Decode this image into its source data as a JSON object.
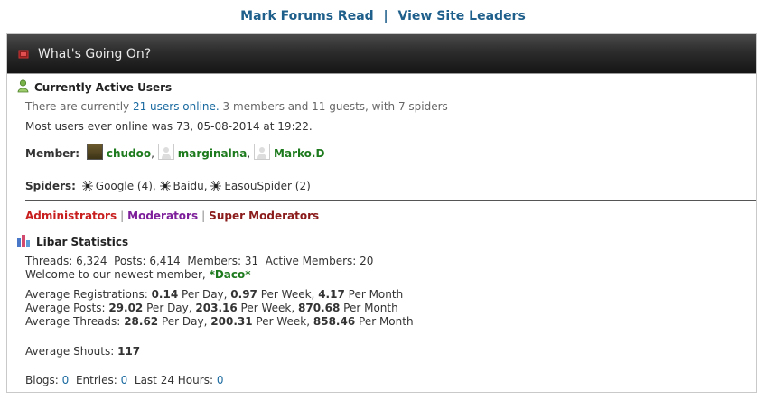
{
  "top_links": {
    "mark_forums_read": "Mark Forums Read",
    "separator": "|",
    "view_site_leaders": "View Site Leaders"
  },
  "panel": {
    "title": "What's Going On?"
  },
  "active_users": {
    "title": "Currently Active Users",
    "line1_prefix": "There are currently",
    "users_online_link": "21 users online.",
    "line1_suffix": "3 members and 11 guests, with 7 spiders",
    "most_users": "Most users ever online was 73, 05-08-2014 at 19:22.",
    "member_label": "Member:",
    "members": [
      "chudoo",
      "marginalna",
      "Marko.D"
    ],
    "spiders_label": "Spiders:",
    "spiders": [
      "Google (4)",
      "Baidu",
      "EasouSpider (2)"
    ],
    "legend": {
      "administrators": "Administrators",
      "moderators": "Moderators",
      "super_moderators": "Super Moderators",
      "sep": "|"
    }
  },
  "statistics": {
    "title": "Libar Statistics",
    "threads_label": "Threads:",
    "threads": "6,324",
    "posts_label": "Posts:",
    "posts": "6,414",
    "members_label": "Members:",
    "members": "31",
    "active_members_label": "Active Members:",
    "active_members": "20",
    "welcome_prefix": "Welcome to our newest member,",
    "newest_member": "*Daco*",
    "avg_reg": {
      "label": "Average Registrations:",
      "day": "0.14",
      "week": "0.97",
      "month": "4.17"
    },
    "avg_posts": {
      "label": "Average Posts:",
      "day": "29.02",
      "week": "203.16",
      "month": "870.68"
    },
    "avg_threads": {
      "label": "Average Threads:",
      "day": "28.62",
      "week": "200.31",
      "month": "858.46"
    },
    "per_day": "Per Day,",
    "per_week": "Per Week,",
    "per_month": "Per Month",
    "avg_shouts_label": "Average Shouts:",
    "avg_shouts": "117",
    "blogs_label": "Blogs:",
    "blogs": "0",
    "entries_label": "Entries:",
    "entries": "0",
    "last24_label": "Last 24 Hours:",
    "last24": "0"
  }
}
